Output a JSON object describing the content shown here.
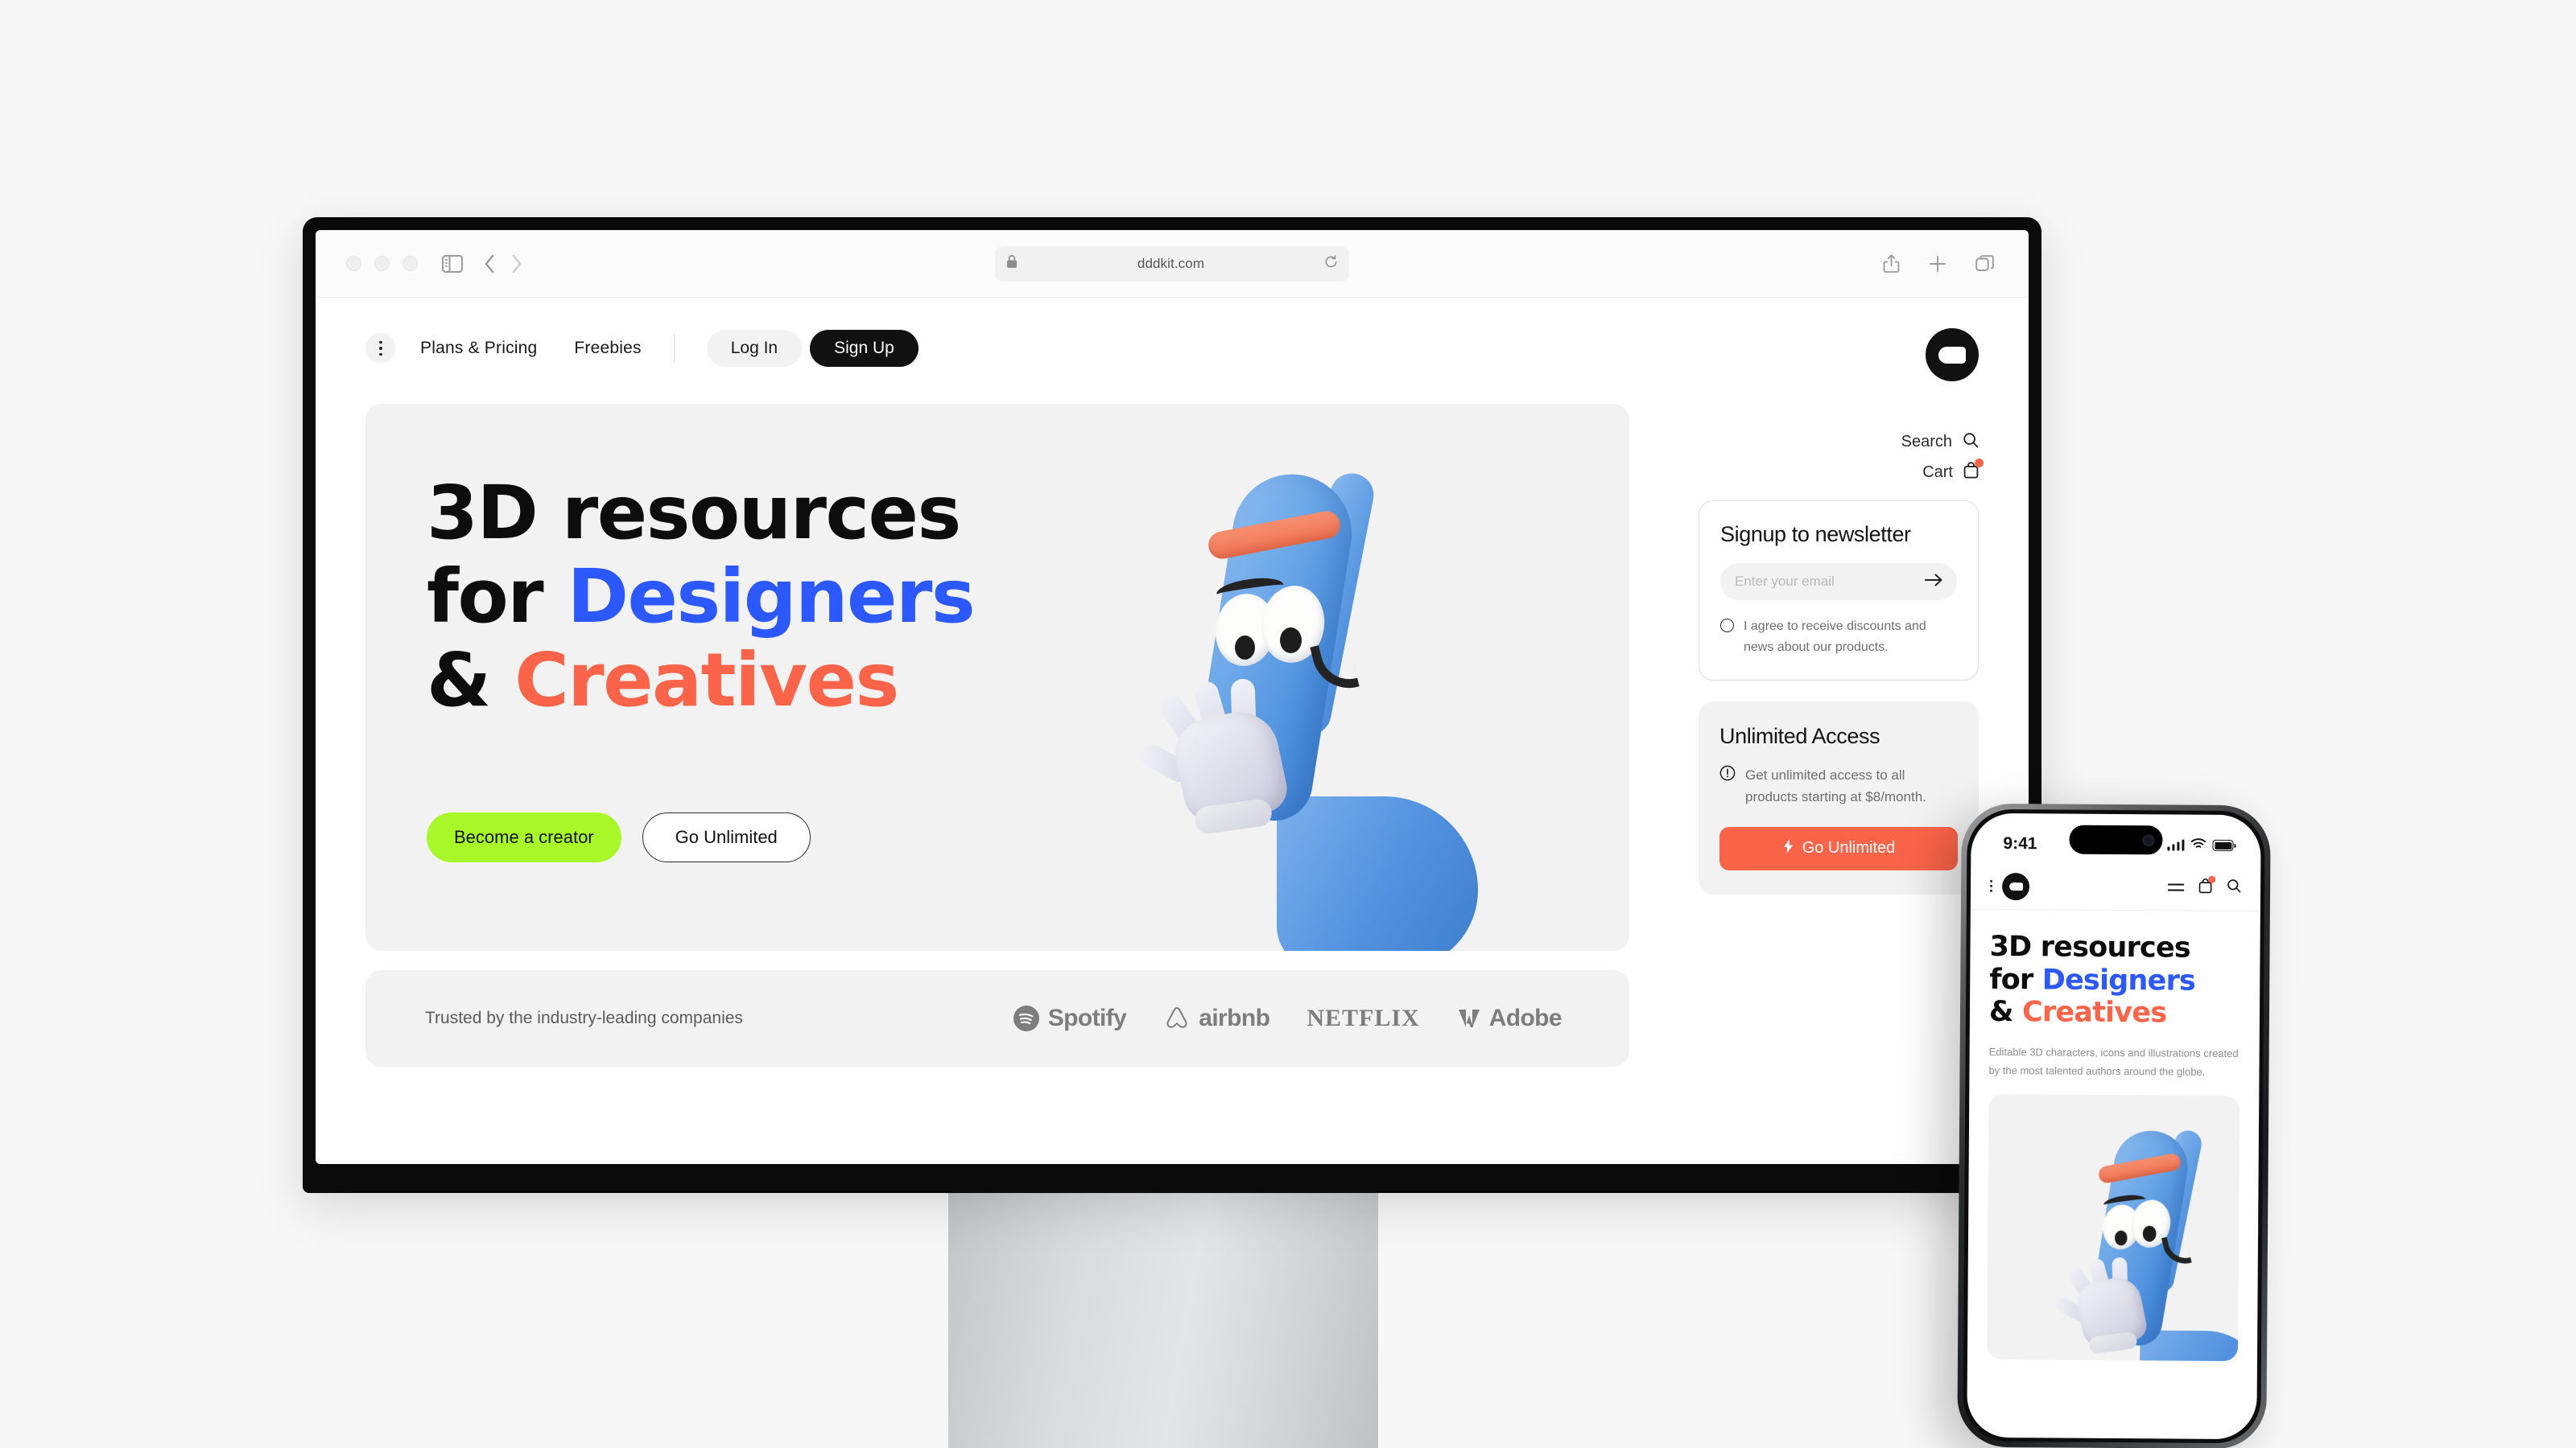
{
  "browser": {
    "url": "dddkit.com",
    "lock_icon": "lock-icon",
    "reload_icon": "reload-icon",
    "sidebar_icon": "sidebar-toggle-icon",
    "back_icon": "chevron-left-icon",
    "forward_icon": "chevron-right-icon",
    "share_icon": "share-icon",
    "newtab_icon": "plus-icon",
    "tabs_icon": "tab-overview-icon"
  },
  "site": {
    "nav": {
      "menu_icon": "kebab-menu-icon",
      "links": [
        "Plans & Pricing",
        "Freebies"
      ],
      "login_label": "Log In",
      "signup_label": "Sign Up",
      "logo_name": "dddkit-logo"
    },
    "utility": {
      "search_label": "Search",
      "search_icon": "search-icon",
      "cart_label": "Cart",
      "cart_icon": "shopping-bag-icon",
      "cart_badge_color": "#fb6448"
    },
    "hero": {
      "line1": "3D resources",
      "line2_plain": "for ",
      "line2_accent": "Designers",
      "line3_plain": "& ",
      "line3_accent": "Creatives",
      "cta_primary": "Become a creator",
      "cta_secondary": "Go Unlimited",
      "illustration": "blue-3d-character"
    },
    "trusted": {
      "label": "Trusted by the industry-leading companies",
      "logos": [
        "Spotify",
        "airbnb",
        "NETFLIX",
        "Adobe"
      ]
    },
    "newsletter": {
      "title": "Signup to newsletter",
      "email_value": "",
      "email_placeholder": "Enter your email",
      "submit_icon": "arrow-right-icon",
      "consent": "I agree to receive discounts and news about our products."
    },
    "unlimited": {
      "title": "Unlimited Access",
      "info_icon": "info-circle-icon",
      "description": "Get unlimited access to all products starting at $8/month.",
      "button_label": "Go Unlimited",
      "button_icon": "lightning-bolt-icon"
    }
  },
  "phone": {
    "status": {
      "time": "9:41",
      "signal_icon": "cellular-bars-icon",
      "wifi_icon": "wifi-icon",
      "battery_icon": "battery-icon"
    },
    "nav": {
      "menu_icon": "kebab-menu-icon",
      "logo_name": "dddkit-logo",
      "hamburger_icon": "hamburger-icon",
      "cart_icon": "shopping-bag-icon",
      "search_icon": "search-icon"
    },
    "hero": {
      "line1": "3D resources",
      "line2_plain": "for ",
      "line2_accent": "Designers",
      "line3_plain": "& ",
      "line3_accent": "Creatives",
      "subtitle": "Editable 3D characters, icons and illustrations created by the most talented authors around the globe.",
      "illustration": "blue-3d-character"
    }
  },
  "colors": {
    "blue": "#2b58ff",
    "orange": "#fb6448",
    "lime": "#a8f829",
    "dark": "#111111",
    "surface": "#f2f2f2",
    "page_bg": "#f7f7f7"
  }
}
